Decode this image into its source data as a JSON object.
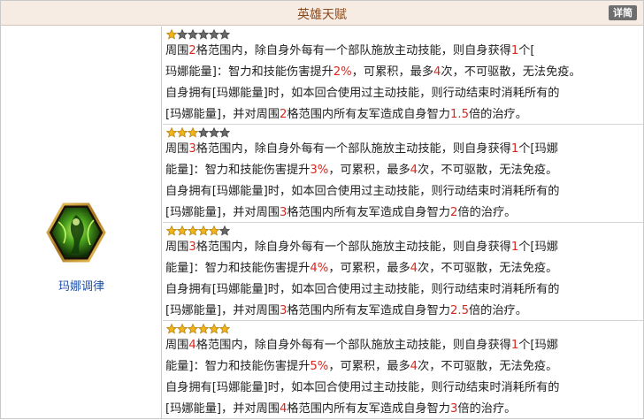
{
  "header": {
    "title": "英雄天赋",
    "detail_label": "详简"
  },
  "hero": {
    "name": "玛娜调律",
    "icon": "mana-tuning-hexagon-icon"
  },
  "colors": {
    "highlight": "#d8281f",
    "star_filled": "#f1b51c",
    "star_empty": "#6a6a6a",
    "link": "#1f4fa8"
  },
  "levels": [
    {
      "stars_filled": 1,
      "stars_total": 6,
      "lines": [
        [
          "周围",
          "2",
          "格范围内，除自身外每有一个部队施放主动技能，则自身获得",
          "1",
          "个["
        ],
        [
          "玛娜能量]：智力和技能伤害提升",
          "2%",
          "，可累积，最多",
          "4",
          "次，不可驱散，无法免疫。"
        ],
        [
          "自身拥有[玛娜能量]时，如本回合使用过主动技能，则行动结束时消耗所有的"
        ],
        [
          "[玛娜能量]，并对周围",
          "2",
          "格范围内所有友军造成自身智力",
          "1.5",
          "倍的治疗。"
        ]
      ]
    },
    {
      "stars_filled": 3,
      "stars_total": 6,
      "lines": [
        [
          "周围",
          "3",
          "格范围内，除自身外每有一个部队施放主动技能，则自身获得",
          "1",
          "个[玛娜"
        ],
        [
          "能量]：智力和技能伤害提升",
          "3%",
          "，可累积，最多",
          "4",
          "次，不可驱散，无法免疫。"
        ],
        [
          "自身拥有[玛娜能量]时，如本回合使用过主动技能，则行动结束时消耗所有的"
        ],
        [
          "[玛娜能量]，并对周围",
          "3",
          "格范围内所有友军造成自身智力",
          "2",
          "倍的治疗。"
        ]
      ]
    },
    {
      "stars_filled": 5,
      "stars_total": 6,
      "lines": [
        [
          "周围",
          "3",
          "格范围内，除自身外每有一个部队施放主动技能，则自身获得",
          "1",
          "个[玛娜"
        ],
        [
          "能量]：智力和技能伤害提升",
          "4%",
          "，可累积，最多",
          "4",
          "次，不可驱散，无法免疫。"
        ],
        [
          "自身拥有[玛娜能量]时，如本回合使用过主动技能，则行动结束时消耗所有的"
        ],
        [
          "[玛娜能量]，并对周围",
          "3",
          "格范围内所有友军造成自身智力",
          "2.5",
          "倍的治疗。"
        ]
      ]
    },
    {
      "stars_filled": 6,
      "stars_total": 6,
      "lines": [
        [
          "周围",
          "4",
          "格范围内，除自身外每有一个部队施放主动技能，则自身获得",
          "1",
          "个[玛娜"
        ],
        [
          "能量]：智力和技能伤害提升",
          "5%",
          "，可累积，最多",
          "4",
          "次，不可驱散，无法免疫。"
        ],
        [
          "自身拥有[玛娜能量]时，如本回合使用过主动技能，则行动结束时消耗所有的"
        ],
        [
          "[玛娜能量]，并对周围",
          "4",
          "格范围内所有友军造成自身智力",
          "3",
          "倍的治疗。"
        ]
      ]
    }
  ]
}
